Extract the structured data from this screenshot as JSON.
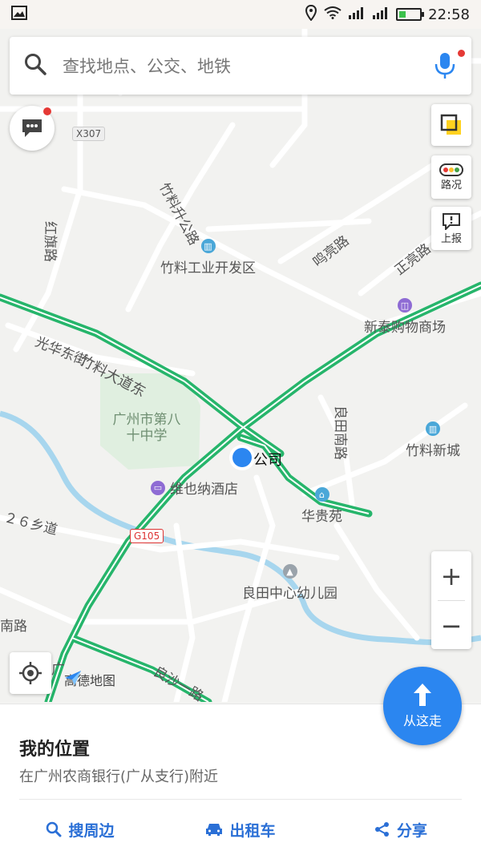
{
  "status_bar": {
    "time": "22:58",
    "battery_level": 0.35,
    "icons": [
      "image-icon",
      "location-icon",
      "wifi-icon",
      "signal-icon",
      "signal-icon",
      "battery-icon"
    ]
  },
  "search": {
    "placeholder": "查找地点、公交、地铁",
    "icon": "search-icon",
    "voice_icon": "microphone-icon"
  },
  "map": {
    "labels": {
      "x307": "X307",
      "g105": "G105",
      "zhuliao_shengtan": "竹料升公路",
      "hongqi": "红旗路",
      "mingliang": "鸣亮路",
      "zhengliang": "正亮路",
      "guanghua": "光华东街",
      "zhuliao_dadao": "竹料大道东",
      "liangtian_nan": "良田南路",
      "ershiliu": "２６乡道",
      "nanlu": "南路",
      "liangsha": "良沙一路",
      "guang": "广"
    },
    "pois": {
      "industrial_zone": "竹料工业开发区",
      "xintai": "新泰购物商场",
      "school": "广州市第八十中学",
      "zhuliao_new_city": "竹料新城",
      "company": "公司",
      "hotel": "维也纳酒店",
      "huagui": "华贵苑",
      "kindergarten": "良田中心幼儿园"
    },
    "logo": "高德地图",
    "colors": {
      "highway": "#26b56b",
      "river": "#a7d6ee",
      "green_area": "#e0efe0",
      "location": "#2b86f0"
    }
  },
  "controls": {
    "traffic_label": "路况",
    "report_label": "上报",
    "zoom_in": "+",
    "zoom_out": "−",
    "go_here": "从这走"
  },
  "panel": {
    "title": "我的位置",
    "subtitle": "在广州农商银行(广从支行)附近",
    "actions": {
      "nearby": "搜周边",
      "taxi": "出租车",
      "share": "分享"
    }
  }
}
